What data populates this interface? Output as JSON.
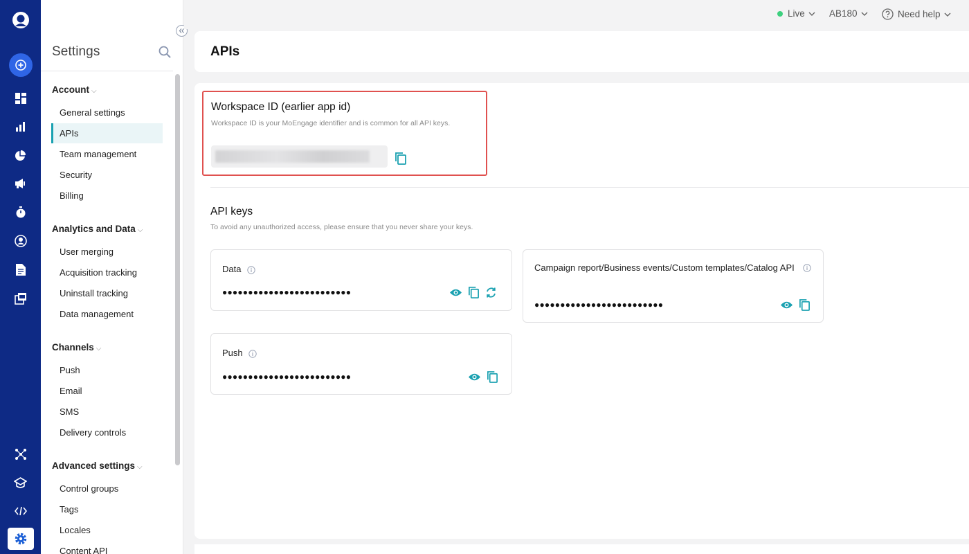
{
  "rail": {
    "icons": [
      "user-logo-icon",
      "create-icon",
      "dashboard-icon",
      "analytics-icon",
      "segments-icon",
      "campaigns-icon",
      "timer-icon",
      "user-profile-icon",
      "reports-icon",
      "content-icon",
      "integrations-icon",
      "academy-icon",
      "developer-icon",
      "settings-icon"
    ]
  },
  "sidebar": {
    "title": "Settings",
    "sections": [
      {
        "heading": "Account",
        "items": [
          "General settings",
          "APIs",
          "Team management",
          "Security",
          "Billing"
        ]
      },
      {
        "heading": "Analytics and Data",
        "items": [
          "User merging",
          "Acquisition tracking",
          "Uninstall tracking",
          "Data management"
        ]
      },
      {
        "heading": "Channels",
        "items": [
          "Push",
          "Email",
          "SMS",
          "Delivery controls"
        ]
      },
      {
        "heading": "Advanced settings",
        "items": [
          "Control groups",
          "Tags",
          "Locales",
          "Content API"
        ]
      }
    ],
    "active_item": "APIs"
  },
  "topbar": {
    "env_label": "Live",
    "env_color": "#3dd07e",
    "workspace": "AB180",
    "help_label": "Need help"
  },
  "page": {
    "title": "APIs"
  },
  "workspace_id": {
    "title": "Workspace ID (earlier app id)",
    "description": "Workspace ID is your MoEngage identifier and is common for all API keys."
  },
  "api_keys": {
    "title": "API keys",
    "description": "To avoid any unauthorized access, please ensure that you never share your keys.",
    "cards": [
      {
        "name": "Data",
        "masked_value": "●●●●●●●●●●●●●●●●●●●●●●●●●"
      },
      {
        "name": "Campaign report/Business events/Custom templates/Catalog API",
        "masked_value": "●●●●●●●●●●●●●●●●●●●●●●●●●"
      },
      {
        "name": "Push",
        "masked_value": "●●●●●●●●●●●●●●●●●●●●●●●●●"
      }
    ]
  },
  "colors": {
    "rail_bg": "#0e2a85",
    "accent_teal": "#1aa1b1",
    "highlight_border": "#e0514f"
  }
}
